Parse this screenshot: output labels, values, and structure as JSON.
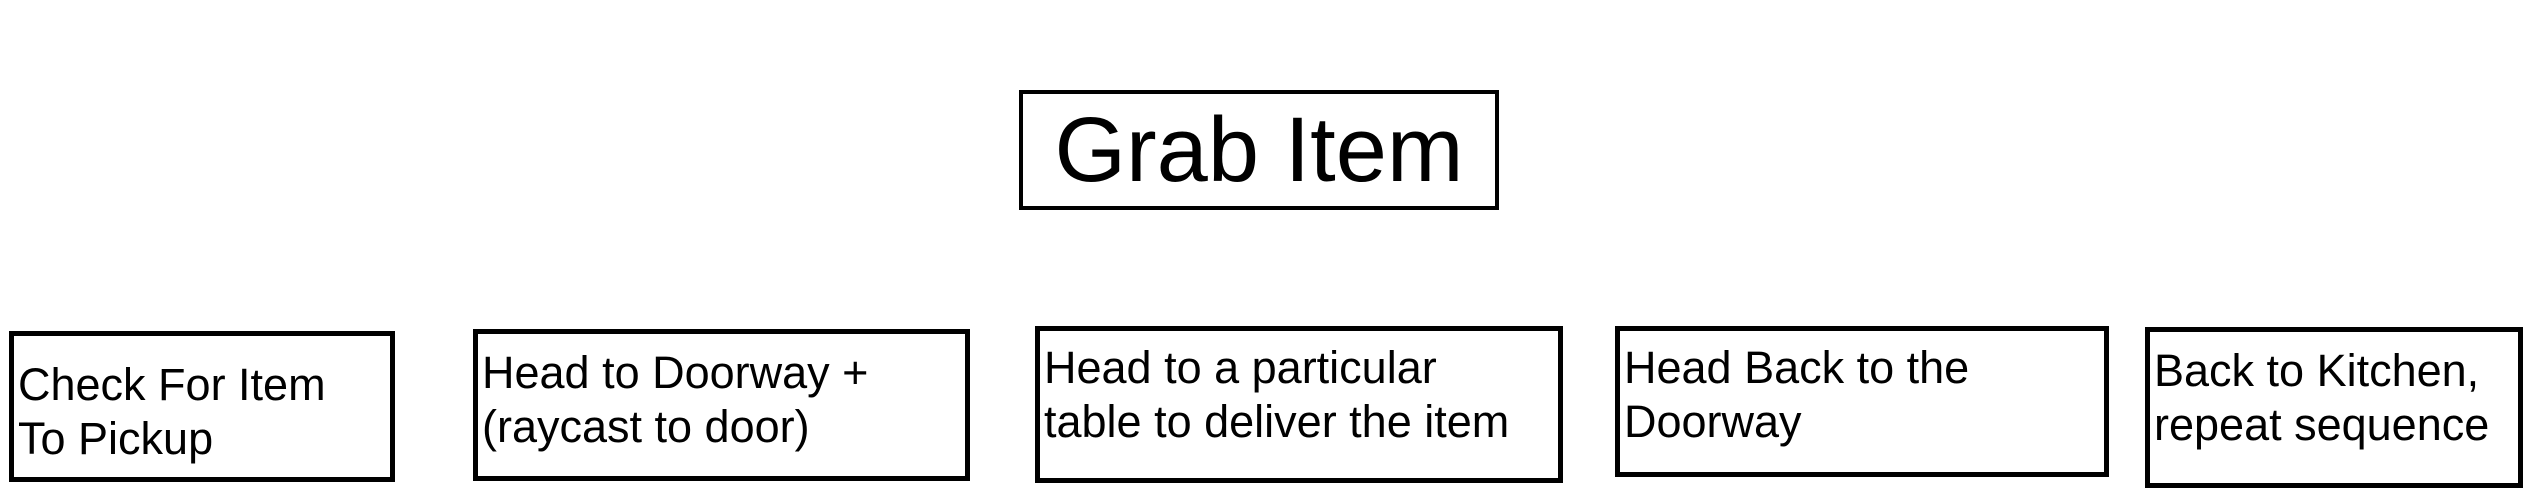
{
  "title": "Grab Item",
  "steps": [
    {
      "line1": "Check For Item",
      "line2": "To Pickup"
    },
    {
      "line1": "Head to Doorway +",
      "line2": "(raycast to door)"
    },
    {
      "line1": "Head to a particular",
      "line2": "table to deliver the item"
    },
    {
      "line1": "Head Back to the",
      "line2": "Doorway"
    },
    {
      "line1": "Back to Kitchen,",
      "line2": "repeat sequence"
    }
  ]
}
